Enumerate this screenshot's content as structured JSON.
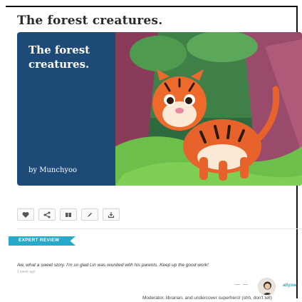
{
  "page": {
    "title": "The forest creatures."
  },
  "cover": {
    "title": "The forest creatures.",
    "author": "by Munchyoo",
    "illustration": "tiger-illustration"
  },
  "toolbar": {
    "buttons": [
      {
        "icon": "heart-icon"
      },
      {
        "icon": "share-icon"
      },
      {
        "icon": "book-icon"
      },
      {
        "icon": "pencil-icon"
      },
      {
        "icon": "download-icon"
      }
    ]
  },
  "review": {
    "badge": "EXPERT REVIEW",
    "text": "Aw, what a sweet story. I'm so glad Lin was reunited with his parents. Keep up the good work!",
    "time": "1 week ago",
    "separator": "— —",
    "reviewer": {
      "name": "allysw",
      "bio": "Moderator, librarian, and undercover superhero! (shh, don't tell)"
    }
  },
  "colors": {
    "accent": "#27a9c9",
    "cover_panel": "#1e4a78"
  }
}
